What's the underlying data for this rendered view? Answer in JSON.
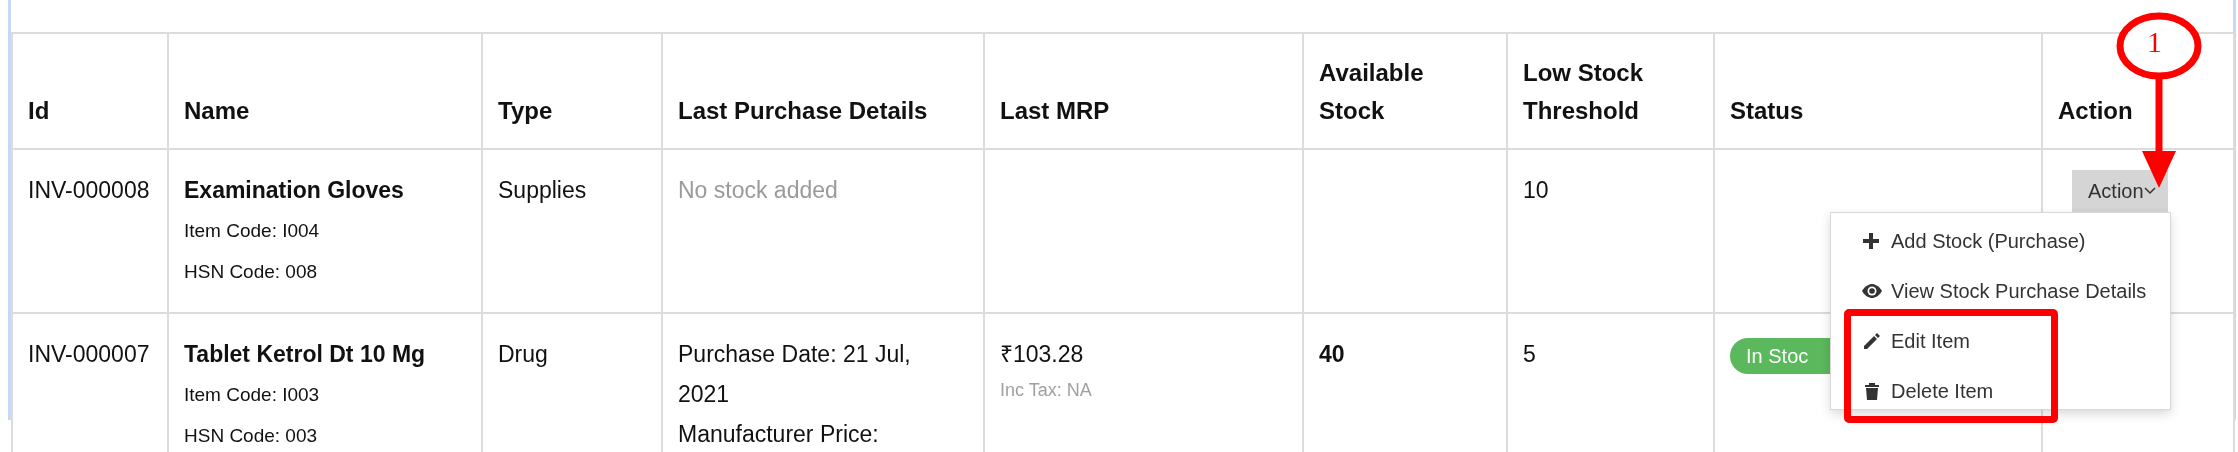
{
  "table": {
    "columns": [
      "Id",
      "Name",
      "Type",
      "Last Purchase Details",
      "Last MRP",
      "Available Stock",
      "Low Stock Threshold",
      "Status",
      "Action"
    ],
    "rows": [
      {
        "id": "INV-000008",
        "name": "Examination Gloves",
        "item_code": "Item Code: I004",
        "hsn_code": "HSN Code: 008",
        "type": "Supplies",
        "last_purchase": {
          "kind": "empty",
          "lines": [
            "No stock added"
          ]
        },
        "low_stock_threshold": "10",
        "action_button": "Action"
      },
      {
        "id": "INV-000007",
        "name": "Tablet Ketrol Dt 10 Mg",
        "item_code": "Item Code: I003",
        "hsn_code": "HSN Code: 003",
        "type": "Drug",
        "last_purchase": {
          "kind": "details",
          "lines": [
            "Purchase Date: 21 Jul, 2021",
            "Manufacturer Price:"
          ]
        },
        "last_mrp": "₹103.28",
        "mrp_note": "Inc Tax: NA",
        "available_stock": "40",
        "low_stock_threshold": "5",
        "status": "In Stoc"
      }
    ]
  },
  "action_menu": {
    "items": [
      {
        "label": "Add Stock (Purchase)",
        "highlighted": false
      },
      {
        "label": "View Stock Purchase Details",
        "highlighted": false
      },
      {
        "label": "Edit Item",
        "highlighted": true
      },
      {
        "label": "Delete Item",
        "highlighted": true
      }
    ]
  },
  "annotation": {
    "number": "1"
  }
}
